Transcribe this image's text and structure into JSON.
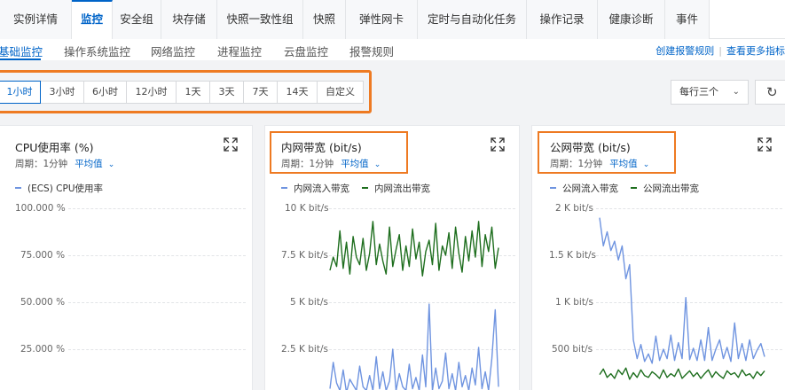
{
  "tabs": [
    "实例详情",
    "监控",
    "安全组",
    "块存储",
    "快照一致性组",
    "快照",
    "弹性网卡",
    "定时与自动化任务",
    "操作记录",
    "健康诊断",
    "事件"
  ],
  "subnav": {
    "items": [
      "基础监控",
      "操作系统监控",
      "网络监控",
      "进程监控",
      "云盘监控",
      "报警规则"
    ],
    "create_alarm": "创建报警规则",
    "view_more": "查看更多指标"
  },
  "time_ranges": [
    "1小时",
    "3小时",
    "6小时",
    "12小时",
    "1天",
    "3天",
    "7天",
    "14天",
    "自定义"
  ],
  "per_row": "每行三个",
  "cards": [
    {
      "title": "CPU使用率 (%)",
      "period": "周期：1分钟",
      "agg": "平均值",
      "legend": [
        "(ECS) CPU使用率"
      ],
      "yticks": [
        "100.000 %",
        "75.000 %",
        "50.000 %",
        "25.000 %"
      ]
    },
    {
      "title": "内网带宽 (bit/s)",
      "period": "周期：1分钟",
      "agg": "平均值",
      "legend": [
        "内网流入带宽",
        "内网流出带宽"
      ],
      "yticks": [
        "10 K bit/s",
        "7.5 K bit/s",
        "5 K bit/s",
        "2.5 K bit/s"
      ]
    },
    {
      "title": "公网带宽 (bit/s)",
      "period": "周期：1分钟",
      "agg": "平均值",
      "legend": [
        "公网流入带宽",
        "公网流出带宽"
      ],
      "yticks": [
        "2 K bit/s",
        "1.5 K bit/s",
        "1 K bit/s",
        "500  bit/s"
      ]
    }
  ],
  "colors": {
    "accent": "#0064c8",
    "highlight": "#ee7a22",
    "series_in": "#6f94e0",
    "series_out": "#1e6e1e"
  },
  "chart_data": [
    {
      "type": "line",
      "title": "CPU使用率 (%)",
      "ylim": [
        0,
        100
      ],
      "series": [
        {
          "name": "(ECS) CPU使用率",
          "values": []
        }
      ]
    },
    {
      "type": "line",
      "title": "内网带宽 (bit/s)",
      "ylim": [
        0,
        10000
      ],
      "series": [
        {
          "name": "内网流入带宽",
          "values": [
            400,
            1800,
            700,
            300,
            1400,
            200,
            900,
            600,
            300,
            1600,
            500,
            300,
            1100,
            300,
            2100,
            400,
            1300,
            300,
            800,
            2500,
            300,
            1200,
            500,
            300,
            1700,
            400,
            1000,
            300,
            2200,
            500,
            4900,
            300,
            1500,
            400,
            800,
            2300,
            400,
            1200,
            300,
            1800,
            500,
            1100,
            300,
            1500,
            600,
            2600,
            400,
            1300,
            300,
            2000,
            4600,
            500
          ]
        },
        {
          "name": "内网流出带宽",
          "values": [
            6700,
            7400,
            6900,
            8800,
            6800,
            8200,
            6500,
            8500,
            7400,
            7000,
            8400,
            6700,
            7600,
            9300,
            7000,
            8100,
            7200,
            6500,
            9000,
            6900,
            7800,
            8600,
            6700,
            8000,
            6900,
            8900,
            7300,
            8200,
            6400,
            7700,
            8300,
            7000,
            9200,
            6700,
            8000,
            7500,
            8700,
            6800,
            9000,
            7600,
            6600,
            8500,
            7200,
            8800,
            7400,
            9300,
            6900,
            8600,
            7700,
            9000,
            6800,
            7900
          ]
        }
      ]
    },
    {
      "type": "line",
      "title": "公网带宽 (bit/s)",
      "ylim": [
        0,
        2000
      ],
      "series": [
        {
          "name": "公网流入带宽",
          "values": [
            1900,
            1600,
            1750,
            1550,
            1650,
            1450,
            1600,
            1250,
            1400,
            600,
            400,
            550,
            370,
            450,
            350,
            640,
            380,
            500,
            400,
            650,
            380,
            570,
            400,
            1050,
            390,
            510,
            380,
            600,
            380,
            730,
            380,
            500,
            600,
            400,
            520,
            370,
            780,
            400,
            560,
            380,
            600,
            400,
            490,
            560,
            420
          ]
        },
        {
          "name": "公网流出带宽",
          "values": [
            230,
            290,
            200,
            240,
            190,
            280,
            230,
            300,
            180,
            250,
            200,
            280,
            220,
            200,
            260,
            230,
            190,
            280,
            200,
            240,
            210,
            290,
            190,
            230,
            270,
            210,
            250,
            190,
            240,
            280,
            200,
            260,
            220,
            190,
            270,
            230,
            250,
            200,
            280,
            220,
            240,
            190,
            260,
            220,
            270
          ]
        }
      ]
    }
  ]
}
